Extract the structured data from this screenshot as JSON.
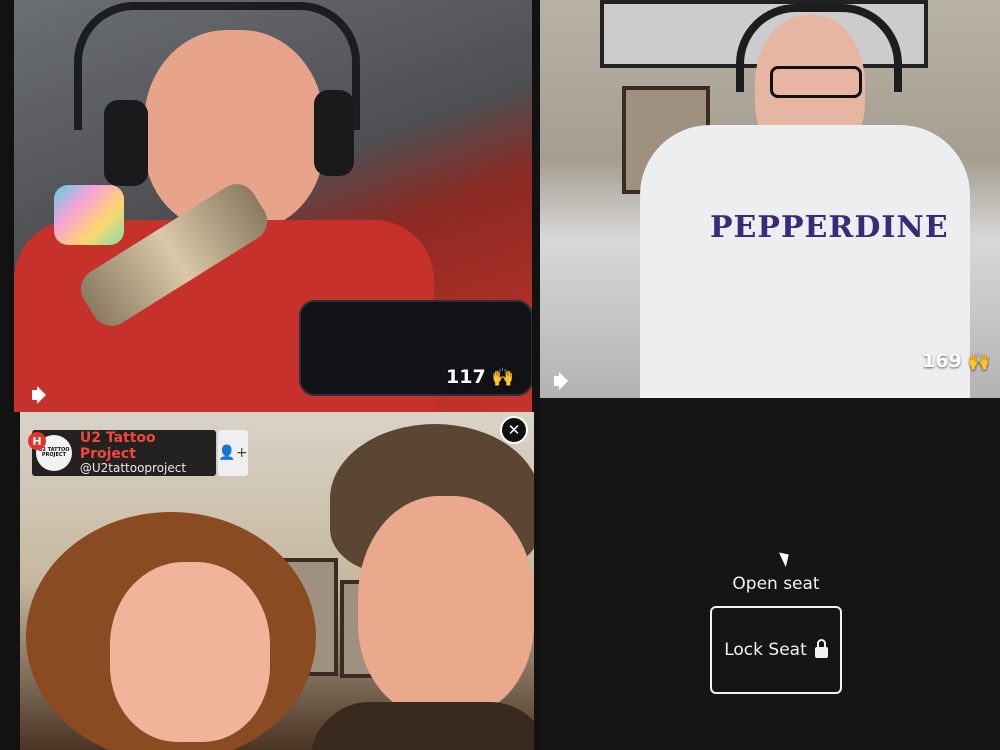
{
  "tiles": {
    "top_left": {
      "count": "117",
      "reaction_icon": "raised-hands-icon",
      "audio_icon": "speaker-icon"
    },
    "top_right": {
      "count": "169",
      "reaction_icon": "raised-hands-icon",
      "audio_icon": "speaker-icon",
      "shirt_text": "PEPPERDINE"
    },
    "bottom_left": {
      "host_badge": "H",
      "host_name": "U2 Tattoo Project",
      "host_handle": "@U2tattooproject",
      "logo_text": "U2 TATTOO PROJECT",
      "add_icon": "add-user-icon",
      "close_icon": "close-icon"
    },
    "bottom_right": {
      "open_seat_label": "Open seat",
      "lock_button_label": "Lock Seat",
      "lock_icon": "lock-icon"
    }
  },
  "colors": {
    "accent": "#f0483e",
    "reaction": "#f5c518",
    "empty_seat_bg": "#151515"
  }
}
